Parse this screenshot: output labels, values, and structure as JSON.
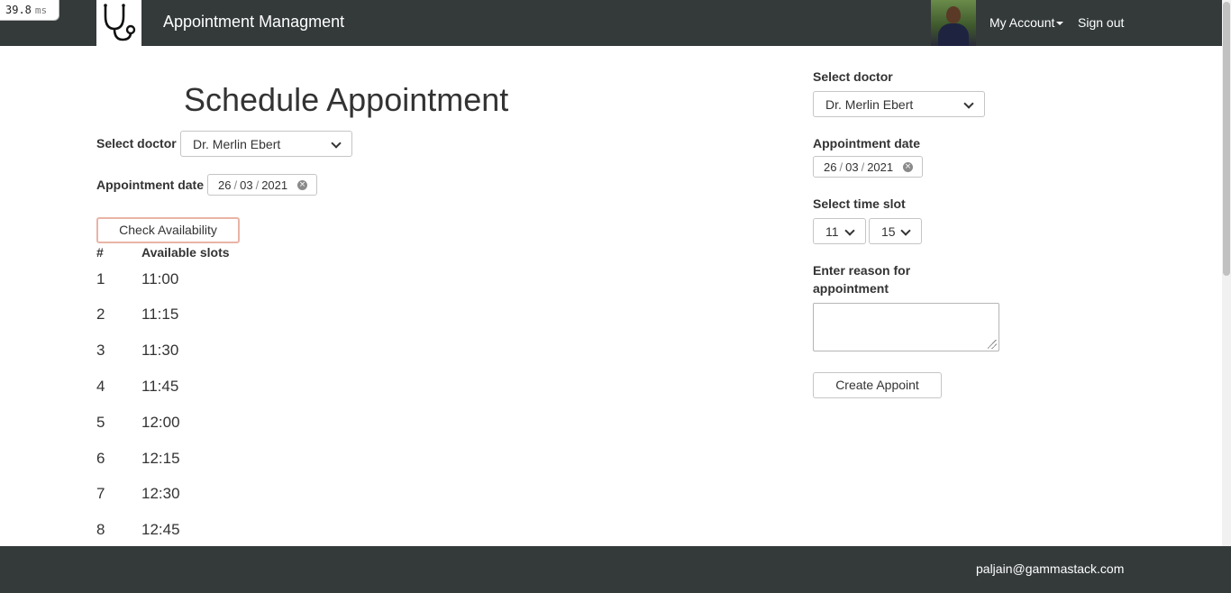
{
  "perf": {
    "value": "39.8",
    "unit": "ms"
  },
  "navbar": {
    "logo_icon": "stethoscope-icon",
    "app_title": "Appointment Managment",
    "account_label": "My Account",
    "signout_label": "Sign out",
    "bg_color": "#343a3a"
  },
  "schedule": {
    "title": "Schedule Appointment",
    "doctor_label": "Select doctor",
    "doctor_value": "Dr. Merlin Ebert",
    "date_label": "Appointment date",
    "date_day": "26",
    "date_month": "03",
    "date_year": "2021",
    "check_button": "Check Availability",
    "col_num": "#",
    "col_slots": "Available slots",
    "slots": [
      {
        "num": "1",
        "time": "11:00"
      },
      {
        "num": "2",
        "time": "11:15"
      },
      {
        "num": "3",
        "time": "11:30"
      },
      {
        "num": "4",
        "time": "11:45"
      },
      {
        "num": "5",
        "time": "12:00"
      },
      {
        "num": "6",
        "time": "12:15"
      },
      {
        "num": "7",
        "time": "12:30"
      },
      {
        "num": "8",
        "time": "12:45"
      }
    ]
  },
  "booking": {
    "doctor_label": "Select doctor",
    "doctor_value": "Dr. Merlin Ebert",
    "date_label": "Appointment date",
    "date_day": "26",
    "date_month": "03",
    "date_year": "2021",
    "timeslot_label": "Select time slot",
    "hour_value": "11",
    "minute_value": "15",
    "reason_label_line1": "Enter reason for",
    "reason_label_line2": "appointment",
    "reason_value": "",
    "create_button": "Create Appoint"
  },
  "footer": {
    "email": "paljain@gammastack.com"
  }
}
